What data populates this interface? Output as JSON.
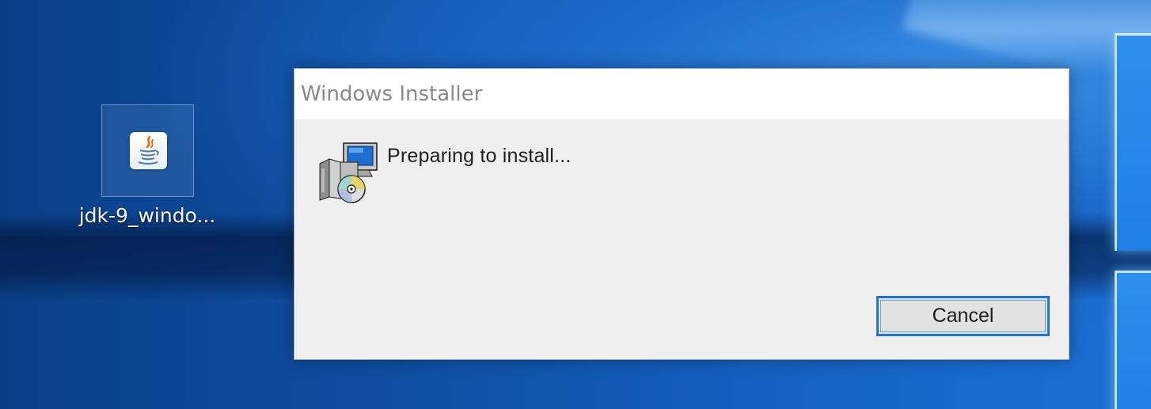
{
  "desktop": {
    "icons": [
      {
        "label": "jdk-9_windo...",
        "icon": "java-installer-icon"
      }
    ]
  },
  "dialog": {
    "title": "Windows Installer",
    "message": "Preparing to install...",
    "icon": "installer-computer-disc-icon",
    "cancel_label": "Cancel"
  },
  "colors": {
    "accent": "#1f74d4",
    "dialog_bg": "#efefef",
    "title_text": "#8a8a8a"
  }
}
